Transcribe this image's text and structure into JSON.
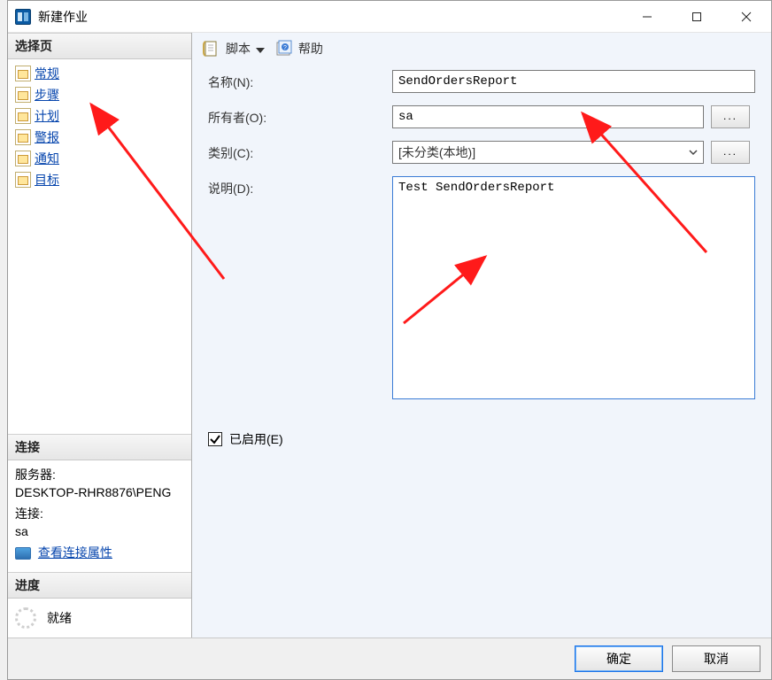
{
  "window": {
    "title": "新建作业"
  },
  "sysbuttons": {
    "min": "—",
    "max": "☐",
    "close": "✕"
  },
  "sidebar": {
    "select_page_header": "选择页",
    "items": [
      {
        "label": "常规"
      },
      {
        "label": "步骤"
      },
      {
        "label": "计划"
      },
      {
        "label": "警报"
      },
      {
        "label": "通知"
      },
      {
        "label": "目标"
      }
    ],
    "connection_header": "连接",
    "connection": {
      "server_label": "服务器:",
      "server_value": "DESKTOP-RHR8876\\PENG",
      "conn_label": "连接:",
      "conn_value": "sa",
      "view_props": "查看连接属性"
    },
    "progress_header": "进度",
    "progress_status": "就绪"
  },
  "toolbar": {
    "script_label": "脚本",
    "help_label": "帮助"
  },
  "form": {
    "name_label": "名称(N):",
    "name_value": "SendOrdersReport",
    "owner_label": "所有者(O):",
    "owner_value": "sa",
    "category_label": "类别(C):",
    "category_value": "[未分类(本地)]",
    "description_label": "说明(D):",
    "description_value": "Test SendOrdersReport",
    "enabled_label": "已启用(E)",
    "ellipsis": "..."
  },
  "buttons": {
    "ok": "确定",
    "cancel": "取消"
  }
}
